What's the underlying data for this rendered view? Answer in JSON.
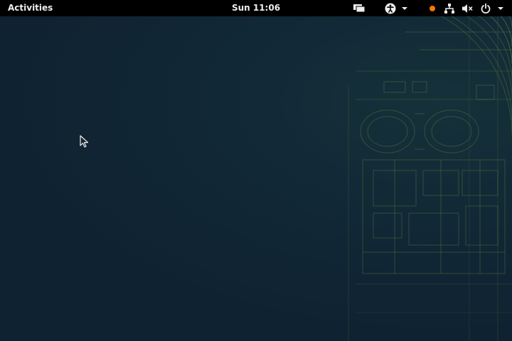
{
  "top_bar": {
    "activities_label": "Activities",
    "clock": "Sun 11:06",
    "background": "#000000",
    "text_color": "#eeeeec",
    "indicators": [
      {
        "icon": "message-tray-icon"
      },
      {
        "icon": "accessibility-icon",
        "menu": true
      },
      {
        "icon": "notification-dot-icon",
        "color": "#f57900"
      },
      {
        "icon": "network-wired-icon"
      },
      {
        "icon": "volume-muted-icon"
      },
      {
        "icon": "power-icon",
        "menu": true
      }
    ]
  },
  "desktop": {
    "background": "#0f2231",
    "wallpaper_line_color": "#6f8f3a"
  }
}
